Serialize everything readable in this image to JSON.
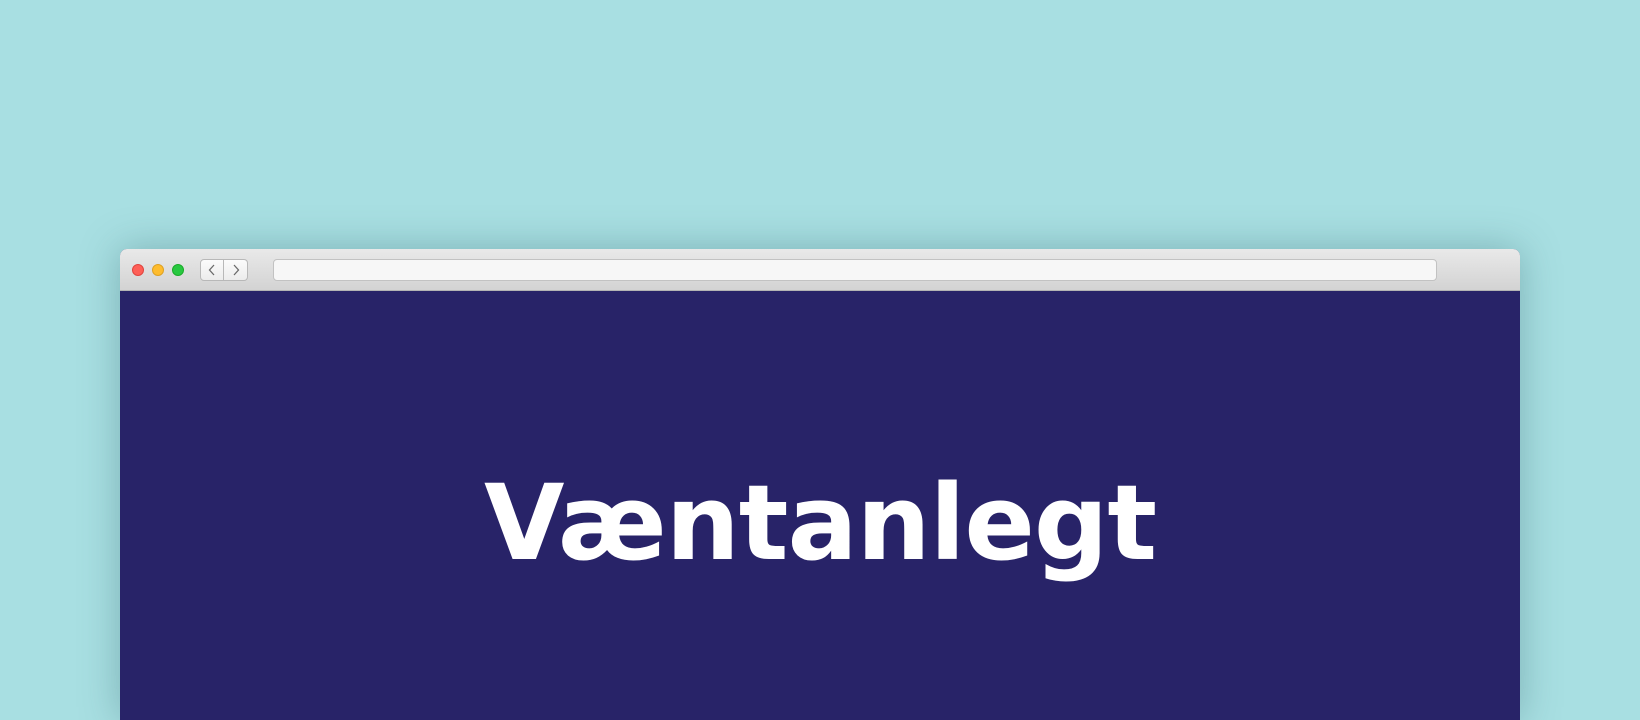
{
  "browser": {
    "address_bar": {
      "value": "",
      "placeholder": ""
    },
    "buttons": {
      "back_icon": "chevron-left-icon",
      "forward_icon": "chevron-right-icon"
    },
    "traffic_lights": {
      "close_color": "#fe5f57",
      "minimize_color": "#febc2e",
      "maximize_color": "#28c840"
    }
  },
  "page": {
    "background_color": "#282368",
    "title": "Væntanlegt",
    "title_color": "#ffffff"
  },
  "backdrop_color": "#a8dfe2"
}
